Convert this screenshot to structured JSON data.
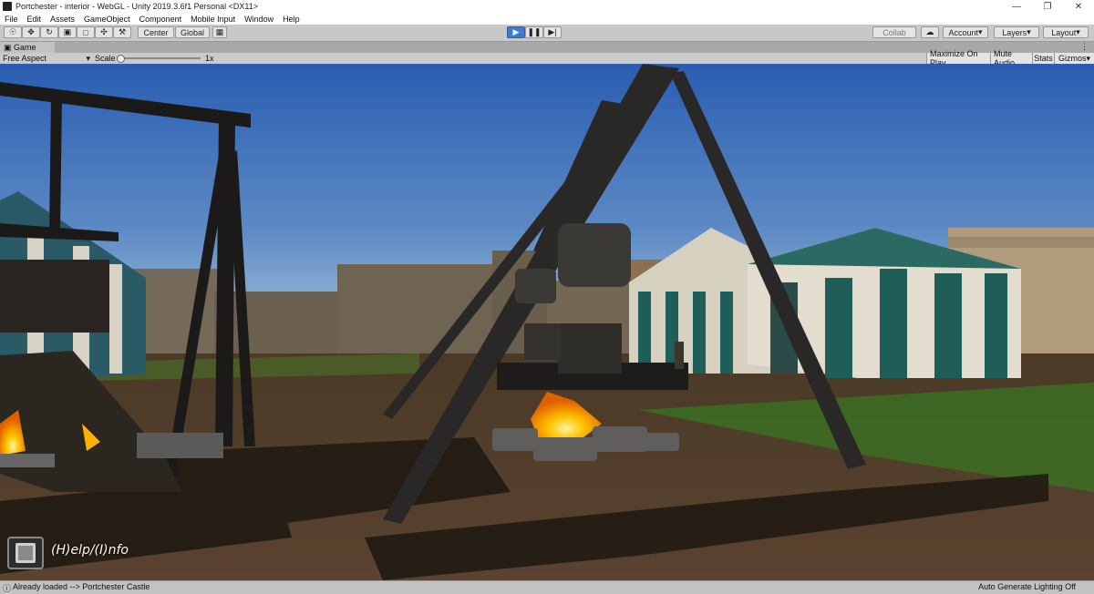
{
  "window": {
    "title": "Portchester - interior - WebGL - Unity 2019.3.6f1 Personal <DX11>"
  },
  "menu": [
    "File",
    "Edit",
    "Assets",
    "GameObject",
    "Component",
    "Mobile Input",
    "Window",
    "Help"
  ],
  "toolbar": {
    "pivot": "Center",
    "space": "Global",
    "collab": "Collab",
    "account": "Account",
    "layers": "Layers",
    "layout": "Layout"
  },
  "tab": {
    "label": "Game"
  },
  "gamebar": {
    "aspect": "Free Aspect",
    "scale_label": "Scale",
    "scale_value": "1x",
    "maximize": "Maximize On Play",
    "mute": "Mute Audio",
    "stats": "Stats",
    "gizmos": "Gizmos"
  },
  "game": {
    "help_text": "(H)elp/(I)nfo"
  },
  "status": {
    "left": "Already loaded --> Portchester Castle",
    "right": "Auto Generate Lighting Off"
  },
  "colors": {
    "sky_top": "#2f64b8",
    "sky_bottom": "#a8c4dc",
    "ground": "#4e3c28",
    "grass": "#3e6a22",
    "wall": "#6e6251",
    "tent_teal": "#1f5d58",
    "fire": "#ffb000",
    "accent": "#3d7bd1"
  }
}
